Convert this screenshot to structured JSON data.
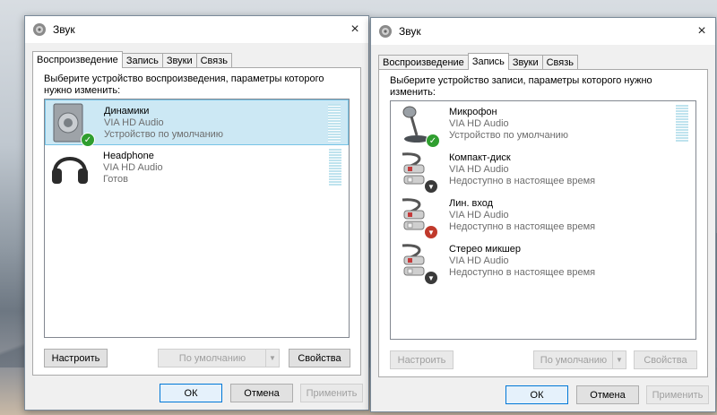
{
  "left": {
    "title": "Звук",
    "tabs": [
      "Воспроизведение",
      "Запись",
      "Звуки",
      "Связь"
    ],
    "prompt": "Выберите устройство воспроизведения, параметры которого нужно изменить:",
    "devices": [
      {
        "name": "Динамики",
        "driver": "VIA HD Audio",
        "status": "Устройство по умолчанию"
      },
      {
        "name": "Headphone",
        "driver": "VIA HD Audio",
        "status": "Готов"
      }
    ],
    "buttons": {
      "configure": "Настроить",
      "set_default": "По умолчанию",
      "properties": "Свойства"
    },
    "footer": {
      "ok": "ОК",
      "cancel": "Отмена",
      "apply": "Применить"
    }
  },
  "right": {
    "title": "Звук",
    "tabs": [
      "Воспроизведение",
      "Запись",
      "Звуки",
      "Связь"
    ],
    "prompt": "Выберите устройство записи, параметры которого нужно изменить:",
    "devices": [
      {
        "name": "Микрофон",
        "driver": "VIA HD Audio",
        "status": "Устройство по умолчанию"
      },
      {
        "name": "Компакт-диск",
        "driver": "VIA HD Audio",
        "status": "Недоступно в настоящее время"
      },
      {
        "name": "Лин. вход",
        "driver": "VIA HD Audio",
        "status": "Недоступно в настоящее время"
      },
      {
        "name": "Стерео микшер",
        "driver": "VIA HD Audio",
        "status": "Недоступно в настоящее время"
      }
    ],
    "buttons": {
      "configure": "Настроить",
      "set_default": "По умолчанию",
      "properties": "Свойства"
    },
    "footer": {
      "ok": "ОК",
      "cancel": "Отмена",
      "apply": "Применить"
    }
  },
  "icons": {
    "close": "×",
    "check": "✓",
    "down_arrow": "▼"
  },
  "colors": {
    "selection_bg": "#cce8f4",
    "selection_border": "#77c4e6",
    "ok_badge": "#2f9e2f",
    "level_meter": "#bfe3ee"
  }
}
